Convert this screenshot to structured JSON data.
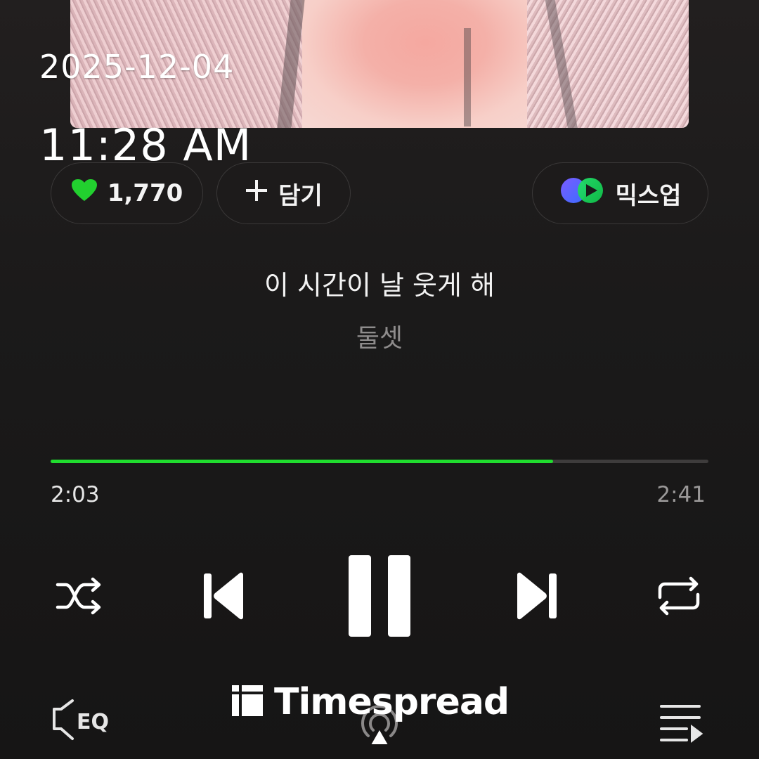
{
  "status": {
    "date": "2025-12-04",
    "time": "11:28 AM"
  },
  "actions": {
    "like_count": "1,770",
    "add_label": "담기",
    "mixup_label": "믹스업"
  },
  "track": {
    "title": "이 시간이 날 웃게 해",
    "artist": "둘셋"
  },
  "playback": {
    "elapsed": "2:03",
    "duration": "2:41",
    "progress_fraction": 0.764,
    "state": "playing"
  },
  "icons": {
    "like": "heart-icon",
    "add": "plus-icon",
    "mixup": "mixup-logo-icon",
    "shuffle": "shuffle-icon",
    "previous": "skip-previous-icon",
    "pause": "pause-icon",
    "next": "skip-next-icon",
    "repeat": "repeat-icon",
    "eq": "eq-icon",
    "cast": "cast-icon",
    "playlist": "playlist-icon",
    "watermark_logo": "timespread-logo-icon"
  },
  "watermark": {
    "text": "Timespread"
  },
  "colors": {
    "accent_green": "#20dc2e",
    "like_heart": "#22d02f",
    "background": "#161515"
  }
}
